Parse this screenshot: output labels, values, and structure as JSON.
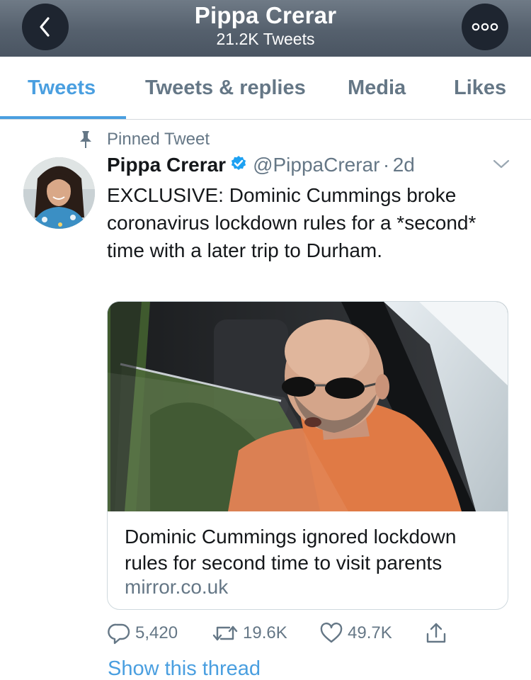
{
  "header": {
    "title": "Pippa Crerar",
    "subtitle": "21.2K Tweets",
    "back_icon": "chevron-left-icon",
    "more_icon": "more-horizontal-icon"
  },
  "tabs": [
    {
      "label": "Tweets",
      "active": true
    },
    {
      "label": "Tweets & replies",
      "active": false
    },
    {
      "label": "Media",
      "active": false
    },
    {
      "label": "Likes",
      "active": false
    }
  ],
  "tweet": {
    "pinned_label": "Pinned Tweet",
    "author_name": "Pippa Crerar",
    "handle": "@PippaCrerar",
    "separator": "·",
    "time": "2d",
    "text": "EXCLUSIVE: Dominic Cummings broke coronavirus lockdown rules for a *second* time with a later trip to Durham.",
    "card": {
      "title": "Dominic Cummings ignored lockdown rules for second time to visit parents",
      "domain": "mirror.co.uk"
    },
    "actions": {
      "replies": "5,420",
      "retweets": "19.6K",
      "likes": "49.7K"
    },
    "show_thread": "Show this thread"
  },
  "colors": {
    "accent": "#4a9fe0",
    "secondary_text": "#657786",
    "verified": "#1da1f2"
  }
}
